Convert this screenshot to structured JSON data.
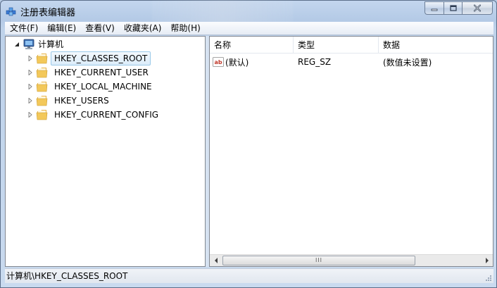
{
  "window": {
    "title": "注册表编辑器"
  },
  "menu": [
    {
      "label": "文件(F)"
    },
    {
      "label": "编辑(E)"
    },
    {
      "label": "查看(V)"
    },
    {
      "label": "收藏夹(A)"
    },
    {
      "label": "帮助(H)"
    }
  ],
  "tree": {
    "root": {
      "label": "计算机",
      "icon": "computer-icon",
      "expanded": true
    },
    "keys": [
      {
        "label": "HKEY_CLASSES_ROOT",
        "icon": "folder-icon",
        "selected": true
      },
      {
        "label": "HKEY_CURRENT_USER",
        "icon": "folder-icon",
        "selected": false
      },
      {
        "label": "HKEY_LOCAL_MACHINE",
        "icon": "folder-icon",
        "selected": false
      },
      {
        "label": "HKEY_USERS",
        "icon": "folder-icon",
        "selected": false
      },
      {
        "label": "HKEY_CURRENT_CONFIG",
        "icon": "folder-icon",
        "selected": false
      }
    ]
  },
  "list": {
    "columns": [
      "名称",
      "类型",
      "数据"
    ],
    "rows": [
      {
        "name": "(默认)",
        "type": "REG_SZ",
        "data": "(数值未设置)",
        "icon": "string-value-icon"
      }
    ]
  },
  "scrollbar": {
    "grip": "III"
  },
  "status": {
    "path": "计算机\\HKEY_CLASSES_ROOT"
  },
  "colors": {
    "titlebar": "#b4cae6",
    "selection": "#dbecfa",
    "selection_border": "#99c8e8",
    "folder": "#f3c85a"
  }
}
